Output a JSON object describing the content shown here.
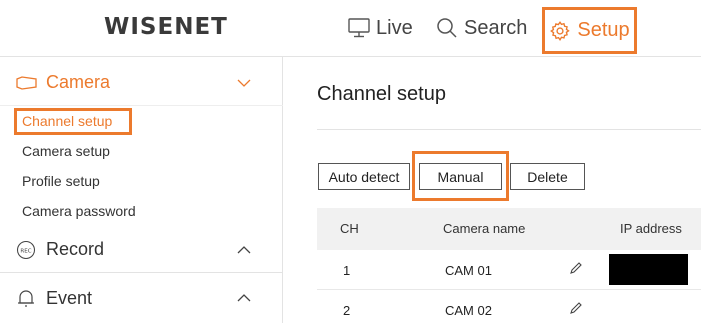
{
  "header": {
    "logo": "WISENET",
    "nav": {
      "live": "Live",
      "search": "Search",
      "setup": "Setup"
    }
  },
  "sidebar": {
    "camera": {
      "label": "Camera",
      "items": [
        "Channel setup",
        "Camera setup",
        "Profile setup",
        "Camera password"
      ]
    },
    "record": {
      "label": "Record"
    },
    "event": {
      "label": "Event"
    }
  },
  "main": {
    "title": "Channel setup",
    "buttons": {
      "auto_detect": "Auto detect",
      "manual": "Manual",
      "delete": "Delete"
    },
    "table": {
      "headers": [
        "CH",
        "Camera name",
        "IP address"
      ],
      "rows": [
        {
          "ch": "1",
          "name": "CAM 01"
        },
        {
          "ch": "2",
          "name": "CAM 02"
        }
      ]
    }
  },
  "colors": {
    "accent": "#ec7a2d",
    "header_row_bg": "#f1f1f1"
  },
  "icons": [
    "monitor-icon",
    "search-icon",
    "gear-icon",
    "camera-icon",
    "chevron-down-icon",
    "record-icon",
    "chevron-up-icon",
    "bell-icon",
    "pencil-icon"
  ]
}
